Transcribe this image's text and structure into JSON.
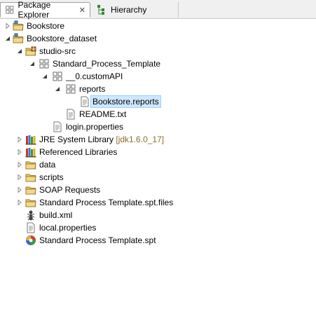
{
  "tabs": [
    {
      "label": "Package Explorer",
      "close": "✕"
    },
    {
      "label": "Hierarchy"
    }
  ],
  "tree": [
    {
      "label": "Bookstore"
    },
    {
      "label": "Bookstore_dataset"
    },
    {
      "label": "studio-src"
    },
    {
      "label": "Standard_Process_Template"
    },
    {
      "label": "__0.customAPI"
    },
    {
      "label": "reports"
    },
    {
      "label": "Bookstore.reports"
    },
    {
      "label": "README.txt"
    },
    {
      "label": "login.properties"
    },
    {
      "label": "JRE System Library",
      "decoration": "[jdk1.6.0_17]"
    },
    {
      "label": "Referenced Libraries"
    },
    {
      "label": "data"
    },
    {
      "label": "scripts"
    },
    {
      "label": "SOAP Requests"
    },
    {
      "label": "Standard Process Template.spt.files"
    },
    {
      "label": "build.xml"
    },
    {
      "label": "local.properties"
    },
    {
      "label": "Standard Process Template.spt"
    }
  ]
}
